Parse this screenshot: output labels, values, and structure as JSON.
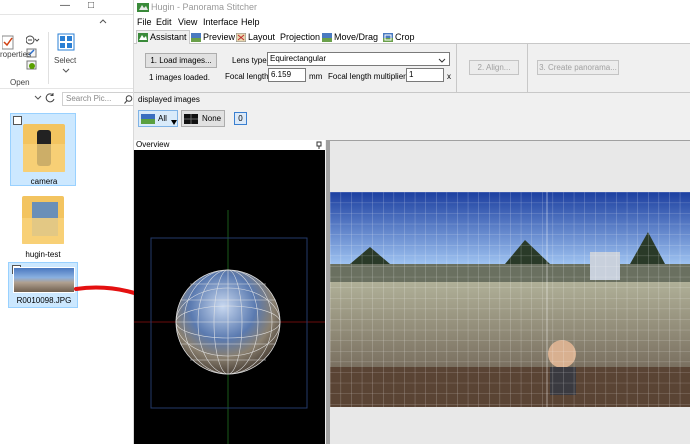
{
  "explorer": {
    "window_controls": [
      "—",
      "□"
    ],
    "ribbon": {
      "properties_label": "roperties",
      "open_label": "Open",
      "select_label": "Select"
    },
    "search_placeholder": "Search Pic...",
    "files": [
      {
        "name": "camera"
      },
      {
        "name": "hugin-test"
      },
      {
        "name": "R0010098.JPG"
      }
    ]
  },
  "hugin": {
    "title": "Hugin - Panorama Stitcher",
    "menu": [
      "File",
      "Edit",
      "View",
      "Interface",
      "Help"
    ],
    "tabs": [
      "Assistant",
      "Preview",
      "Layout",
      "Projection",
      "Move/Drag",
      "Crop"
    ],
    "load_button": "1. Load images...",
    "images_loaded": "1 images loaded.",
    "lens_type_label": "Lens type:",
    "lens_type_value": "Equirectangular",
    "focal_length_label": "Focal length:",
    "focal_length_value": "6.159",
    "focal_unit": "mm",
    "multiplier_label": "Focal length multiplier:",
    "multiplier_value": "1",
    "multiplier_unit": "x",
    "align_button": "2. Align...",
    "create_button": "3. Create panorama...",
    "displayed_images_label": "displayed images",
    "all_button": "All",
    "none_button": "None",
    "image_index": "0",
    "overview_label": "Overview"
  }
}
